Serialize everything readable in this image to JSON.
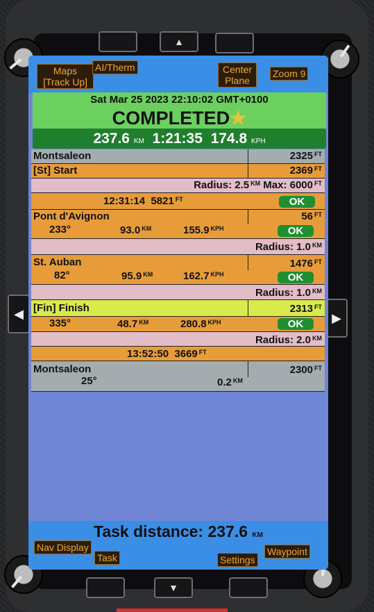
{
  "softkeys": {
    "maps": "Maps\n[Track Up]",
    "ai_therm": "AI/Therm",
    "center_plane": "Center\nPlane",
    "zoom": "Zoom 9",
    "nav_display": "Nav Display",
    "task": "Task",
    "settings": "Settings",
    "waypoint": "Waypoint"
  },
  "hardware": {
    "up": "▲",
    "down": "▼",
    "left": "◀",
    "right": "▶"
  },
  "status": {
    "datetime": "Sat Mar 25 2023 22:10:02 GMT+0100",
    "state": "COMPLETED",
    "star": "★",
    "distance": "237.6",
    "distance_unit": "KM",
    "time": "1:21:35",
    "speed": "174.8",
    "speed_unit": "KPH"
  },
  "waypoints": {
    "start_airport": {
      "name": "Montsaleon",
      "alt": "2325",
      "unit": "FT"
    },
    "start": {
      "name": "[St] Start",
      "alt": "2369",
      "unit": "FT",
      "radius_label": "Radius: 2.5",
      "radius_unit": "KM",
      "max_label": "Max: 6000",
      "max_unit": "FT",
      "time": "12:31:14",
      "time_alt": "5821",
      "time_alt_unit": "FT",
      "ok": "OK"
    },
    "tp1": {
      "name": "Pont d'Avignon",
      "alt": "56",
      "unit": "FT",
      "bearing": "233°",
      "dist": "93.0",
      "dist_unit": "KM",
      "speed": "155.9",
      "speed_unit": "KPH",
      "ok": "OK",
      "radius_label": "Radius: 1.0",
      "radius_unit": "KM"
    },
    "tp2": {
      "name": "St. Auban",
      "alt": "1476",
      "unit": "FT",
      "bearing": "82°",
      "dist": "95.9",
      "dist_unit": "KM",
      "speed": "162.7",
      "speed_unit": "KPH",
      "ok": "OK",
      "radius_label": "Radius: 1.0",
      "radius_unit": "KM"
    },
    "finish": {
      "name": "[Fin] Finish",
      "alt": "2313",
      "unit": "FT",
      "bearing": "335°",
      "dist": "48.7",
      "dist_unit": "KM",
      "speed": "280.8",
      "speed_unit": "KPH",
      "ok": "OK",
      "radius_label": "Radius: 2.0",
      "radius_unit": "KM",
      "time": "13:52:50",
      "time_alt": "3669",
      "time_alt_unit": "FT"
    },
    "end_airport": {
      "name": "Montsaleon",
      "alt": "2300",
      "unit": "FT",
      "bearing": "25°",
      "dist": "0.2",
      "dist_unit": "KM"
    }
  },
  "task_distance": {
    "label": "Task distance: 237.6",
    "unit": "KM"
  },
  "colors": {
    "status_green": "#6cd05f",
    "summary_green": "#1f7f2e",
    "orange": "#e79c39",
    "pink": "#e2bcc7",
    "grey": "#a5acb0",
    "yellow": "#d9eb4c",
    "screen_blue": "#6f86d4"
  }
}
